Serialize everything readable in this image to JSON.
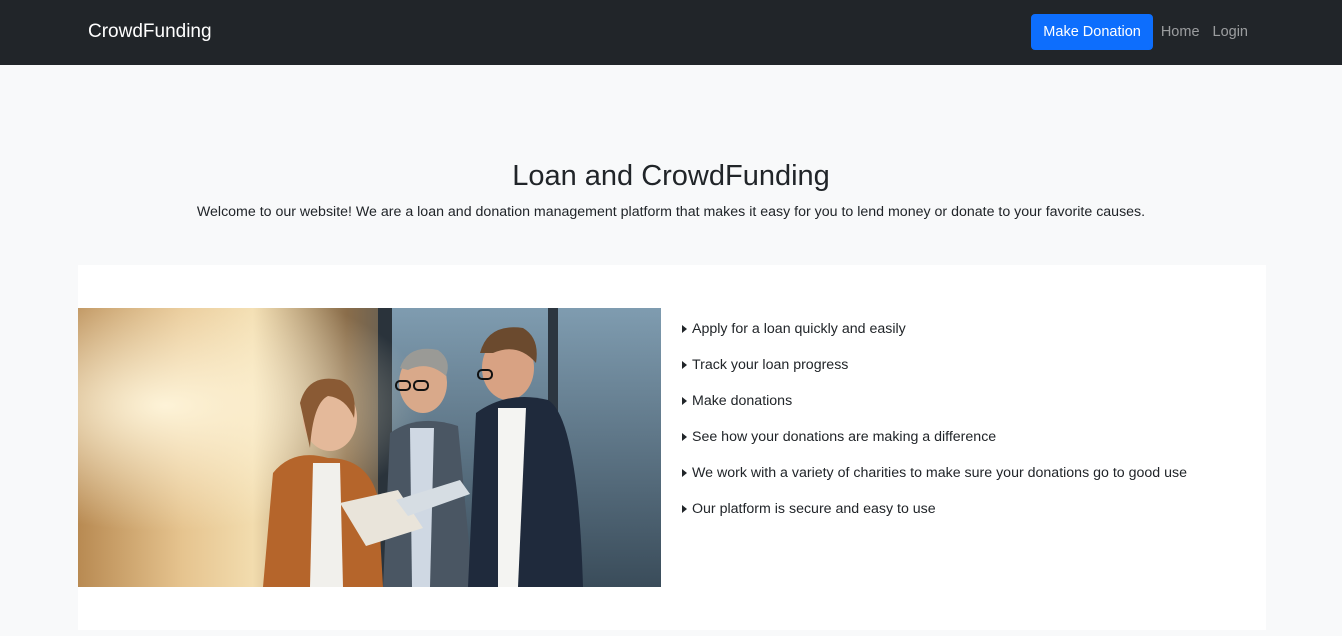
{
  "navbar": {
    "brand": "CrowdFunding",
    "donate_label": "Make Donation",
    "links": [
      "Home",
      "Login"
    ]
  },
  "hero": {
    "title": "Loan and CrowdFunding",
    "subtitle": "Welcome to our website! We are a loan and donation management platform that makes it easy for you to lend money or donate to your favorite causes."
  },
  "features": [
    "Apply for a loan quickly and easily",
    "Track your loan progress",
    "Make donations",
    "See how your donations are making a difference",
    "We work with a variety of charities to make sure your donations go to good use",
    "Our platform is secure and easy to use"
  ],
  "icons": {
    "feature_bullet": "caret-right-icon"
  },
  "colors": {
    "navbar_bg": "#212529",
    "primary": "#0d6efd",
    "page_bg": "#f8f9fa"
  }
}
